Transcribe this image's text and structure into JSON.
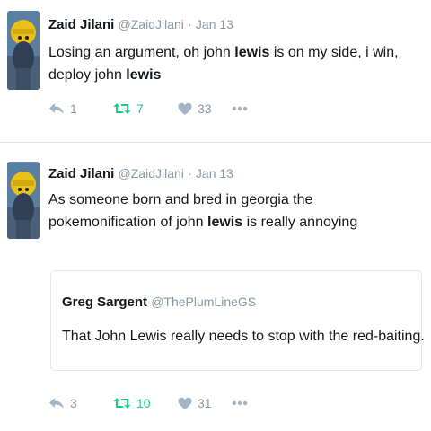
{
  "tweets": [
    {
      "author": {
        "name": "Zaid Jilani",
        "handle": "@ZaidJilani",
        "date": "Jan 13"
      },
      "separator": "·",
      "text_parts": [
        "Losing an argument, oh john ",
        "lewis",
        " is on my side, i win, deploy john ",
        "lewis"
      ],
      "actions": {
        "reply_count": "1",
        "retweet_count": "7",
        "like_count": "33"
      }
    },
    {
      "author": {
        "name": "Zaid Jilani",
        "handle": "@ZaidJilani",
        "date": "Jan 13"
      },
      "separator": "·",
      "text_parts": [
        "As someone born and bred in georgia the pokemonification of john ",
        "lewis",
        " is really annoying"
      ],
      "quote": {
        "name": "Greg Sargent",
        "handle": "@ThePlumLineGS",
        "text": "That John Lewis really needs to  stop with the red-baiting."
      },
      "actions": {
        "reply_count": "3",
        "retweet_count": "10",
        "like_count": "31"
      }
    }
  ],
  "colors": {
    "retweet_active": "#19cf86",
    "muted": "#8899a6",
    "text": "#14171a",
    "border": "#e1e8ed"
  },
  "icons": [
    "reply-icon",
    "retweet-icon",
    "heart-icon",
    "more-icon"
  ]
}
